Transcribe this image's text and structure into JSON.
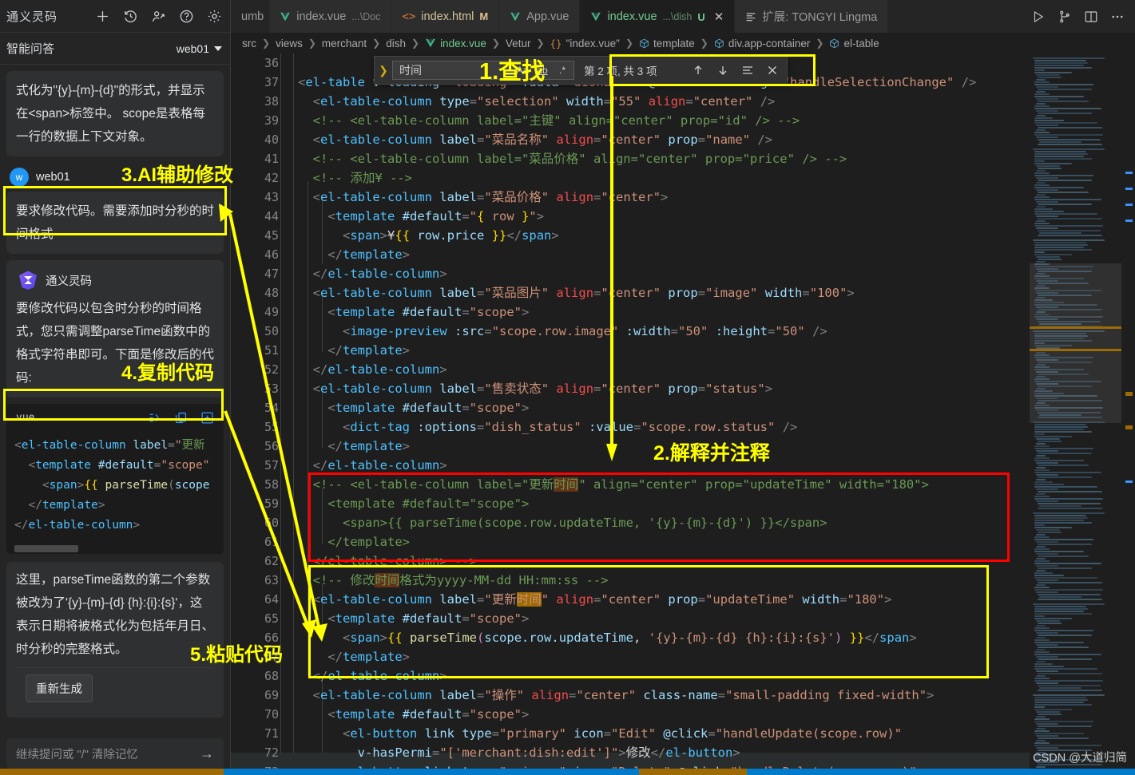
{
  "lingma": {
    "title": "通义灵码",
    "head_icons": [
      "plus-icon",
      "history-icon",
      "share-icon",
      "help-icon",
      "gear-icon"
    ],
    "subtitle": "智能问答",
    "model": "web01",
    "assistant_bubble_top": "式化为\"{y}-{m}-{d}\"的形式，并显示在<span>标签中。 scope是表格每一行的数据上下文对象。",
    "user": {
      "name": "web01",
      "avatar_letter": "w",
      "message": "要求修改代码。需要添加时分秒的时间格式"
    },
    "assistant": {
      "name": "通义灵码",
      "message": "要修改代码以包含时分秒的时间格式，您只需调整parseTime函数中的格式字符串即可。下面是修改后的代码:",
      "code_lang": "vue",
      "code_actions": [
        "insert-at-cursor-icon",
        "copy-icon",
        "new-file-icon"
      ],
      "code_lines": [
        "<el-table-column label=\"更新",
        "  <template #default=\"scope\"",
        "    <span>{{ parseTime(scope",
        "  </template>",
        "</el-table-column>"
      ],
      "explanation": "这里，parseTime函数的第二个参数被改为了'{y}-{m}-{d} {h}:{i}:{s}'，这表示日期将被格式化为包括年月日、时分秒的完整格式。",
      "regenerate_label": "重新生成"
    },
    "input_placeholder": "继续提问或 \"/\" 清除记忆",
    "send_icon": "arrow-right-icon"
  },
  "tabs": [
    {
      "label": "umb",
      "icon": "none",
      "state": "",
      "dim": "",
      "active": false
    },
    {
      "label": "index.vue",
      "icon": "vue-icon",
      "dim": "...\\Doc",
      "state": "",
      "active": false
    },
    {
      "label": "index.html",
      "icon": "html-icon",
      "dim": "",
      "state": "M",
      "active": false
    },
    {
      "label": "App.vue",
      "icon": "vue-icon",
      "dim": "",
      "state": "",
      "active": false
    },
    {
      "label": "index.vue",
      "icon": "vue-icon",
      "dim": "...\\dish",
      "state": "U",
      "active": true
    },
    {
      "label": "扩展: TONGYI Lingma",
      "icon": "extension-icon",
      "dim": "",
      "state": "",
      "active": false
    }
  ],
  "tabbar_right_icons": [
    "run-icon",
    "split-source-control-icon",
    "split-editor-icon",
    "more-actions-icon"
  ],
  "breadcrumb": [
    "src",
    "views",
    "merchant",
    "dish",
    "index.vue",
    "Vetur",
    "\"index.vue\"",
    "template",
    "div.app-container",
    "el-table"
  ],
  "find": {
    "query": "时间",
    "match_case_label": "Aa",
    "whole_word_label": "ab",
    "regex_label": ".*",
    "result_count": "第 2 项, 共 3 项",
    "actions": [
      "previous-match-icon",
      "next-match-icon",
      "find-in-selection-icon",
      "close-icon"
    ]
  },
  "code": {
    "first_line_number": 36,
    "lines": [
      {
        "n": 36,
        "text": ""
      },
      {
        "n": 37,
        "text": "<el-table v-loading=\"loading\" :data=\"dishList\" @selection-change=\"handleSelectionChange\" />"
      },
      {
        "n": 38,
        "text": "  <el-table-column type=\"selection\" width=\"55\" align=\"center\" />"
      },
      {
        "n": 39,
        "text": "  <!-- <el-table-column label=\"主键\" align=\"center\" prop=\"id\" /> -->"
      },
      {
        "n": 40,
        "text": "  <el-table-column label=\"菜品名称\" align=\"center\" prop=\"name\" />"
      },
      {
        "n": 41,
        "text": "  <!-- <el-table-column label=\"菜品价格\" align=\"center\" prop=\"price\" /> -->"
      },
      {
        "n": 42,
        "text": "  <!-- 添加¥ -->"
      },
      {
        "n": 43,
        "text": "  <el-table-column label=\"菜品价格\" align=\"center\">"
      },
      {
        "n": 44,
        "text": "    <template #default=\"{ row }\">"
      },
      {
        "n": 45,
        "text": "      <span>¥{{ row.price }}</span>"
      },
      {
        "n": 46,
        "text": "    </template>"
      },
      {
        "n": 47,
        "text": "  </el-table-column>"
      },
      {
        "n": 48,
        "text": "  <el-table-column label=\"菜品图片\" align=\"center\" prop=\"image\" width=\"100\">"
      },
      {
        "n": 49,
        "text": "    <template #default=\"scope\">"
      },
      {
        "n": 50,
        "text": "      <image-preview :src=\"scope.row.image\" :width=\"50\" :height=\"50\" />"
      },
      {
        "n": 51,
        "text": "    </template>"
      },
      {
        "n": 52,
        "text": "  </el-table-column>"
      },
      {
        "n": 53,
        "text": "  <el-table-column label=\"售卖状态\" align=\"center\" prop=\"status\">"
      },
      {
        "n": 54,
        "text": "    <template #default=\"scope\">"
      },
      {
        "n": 55,
        "text": "      <dict-tag :options=\"dish_status\" :value=\"scope.row.status\" />"
      },
      {
        "n": 56,
        "text": "    </template>"
      },
      {
        "n": 57,
        "text": "  </el-table-column>"
      },
      {
        "n": 58,
        "text": "  <!-- <el-table-column label=\"更新时间\" align=\"center\" prop=\"updateTime\" width=\"180\">"
      },
      {
        "n": 59,
        "text": "    <template #default=\"scope\">"
      },
      {
        "n": 60,
        "text": "      <span>{{ parseTime(scope.row.updateTime, '{y}-{m}-{d}') }}</span>"
      },
      {
        "n": 61,
        "text": "    </template>"
      },
      {
        "n": 62,
        "text": "  </el-table-column> -->"
      },
      {
        "n": 63,
        "text": "  <!-- 修改时间格式为yyyy-MM-dd HH:mm:ss -->"
      },
      {
        "n": 64,
        "text": "  <el-table-column label=\"更新时间\" align=\"center\" prop=\"updateTime\" width=\"180\">"
      },
      {
        "n": 65,
        "text": "    <template #default=\"scope\">"
      },
      {
        "n": 66,
        "text": "      <span>{{ parseTime(scope.row.updateTime, '{y}-{m}-{d} {h}:{i}:{s}') }}</span>"
      },
      {
        "n": 67,
        "text": "    </template>"
      },
      {
        "n": 68,
        "text": "  </el-table-column>"
      },
      {
        "n": 69,
        "text": "  <el-table-column label=\"操作\" align=\"center\" class-name=\"small-padding fixed-width\">"
      },
      {
        "n": 70,
        "text": "    <template #default=\"scope\">"
      },
      {
        "n": 71,
        "text": "      <el-button link type=\"primary\" icon=\"Edit\" @click=\"handleUpdate(scope.row)\""
      },
      {
        "n": 72,
        "text": "        v-hasPermi=\"['merchant:dish:edit']\">修改</el-button>"
      },
      {
        "n": 73,
        "text": "      <el-button link type=\"primary\" icon=\"Delete\" @click=\"handleDelete(scope.row)\""
      }
    ]
  },
  "annotations": [
    {
      "id": "a1",
      "label": "1.查找"
    },
    {
      "id": "a2",
      "label": "2.解释并注释"
    },
    {
      "id": "a3",
      "label": "3.AI辅助修改"
    },
    {
      "id": "a4",
      "label": "4.复制代码"
    },
    {
      "id": "a5",
      "label": "5.粘贴代码"
    }
  ],
  "watermark": "CSDN @大道归简",
  "colors": {
    "annotation_yellow": "#ffff00",
    "annotation_red": "#ff0000",
    "accent_blue": "#007acc",
    "editor_bg": "#1e1e1e",
    "panel_bg": "#252526"
  }
}
